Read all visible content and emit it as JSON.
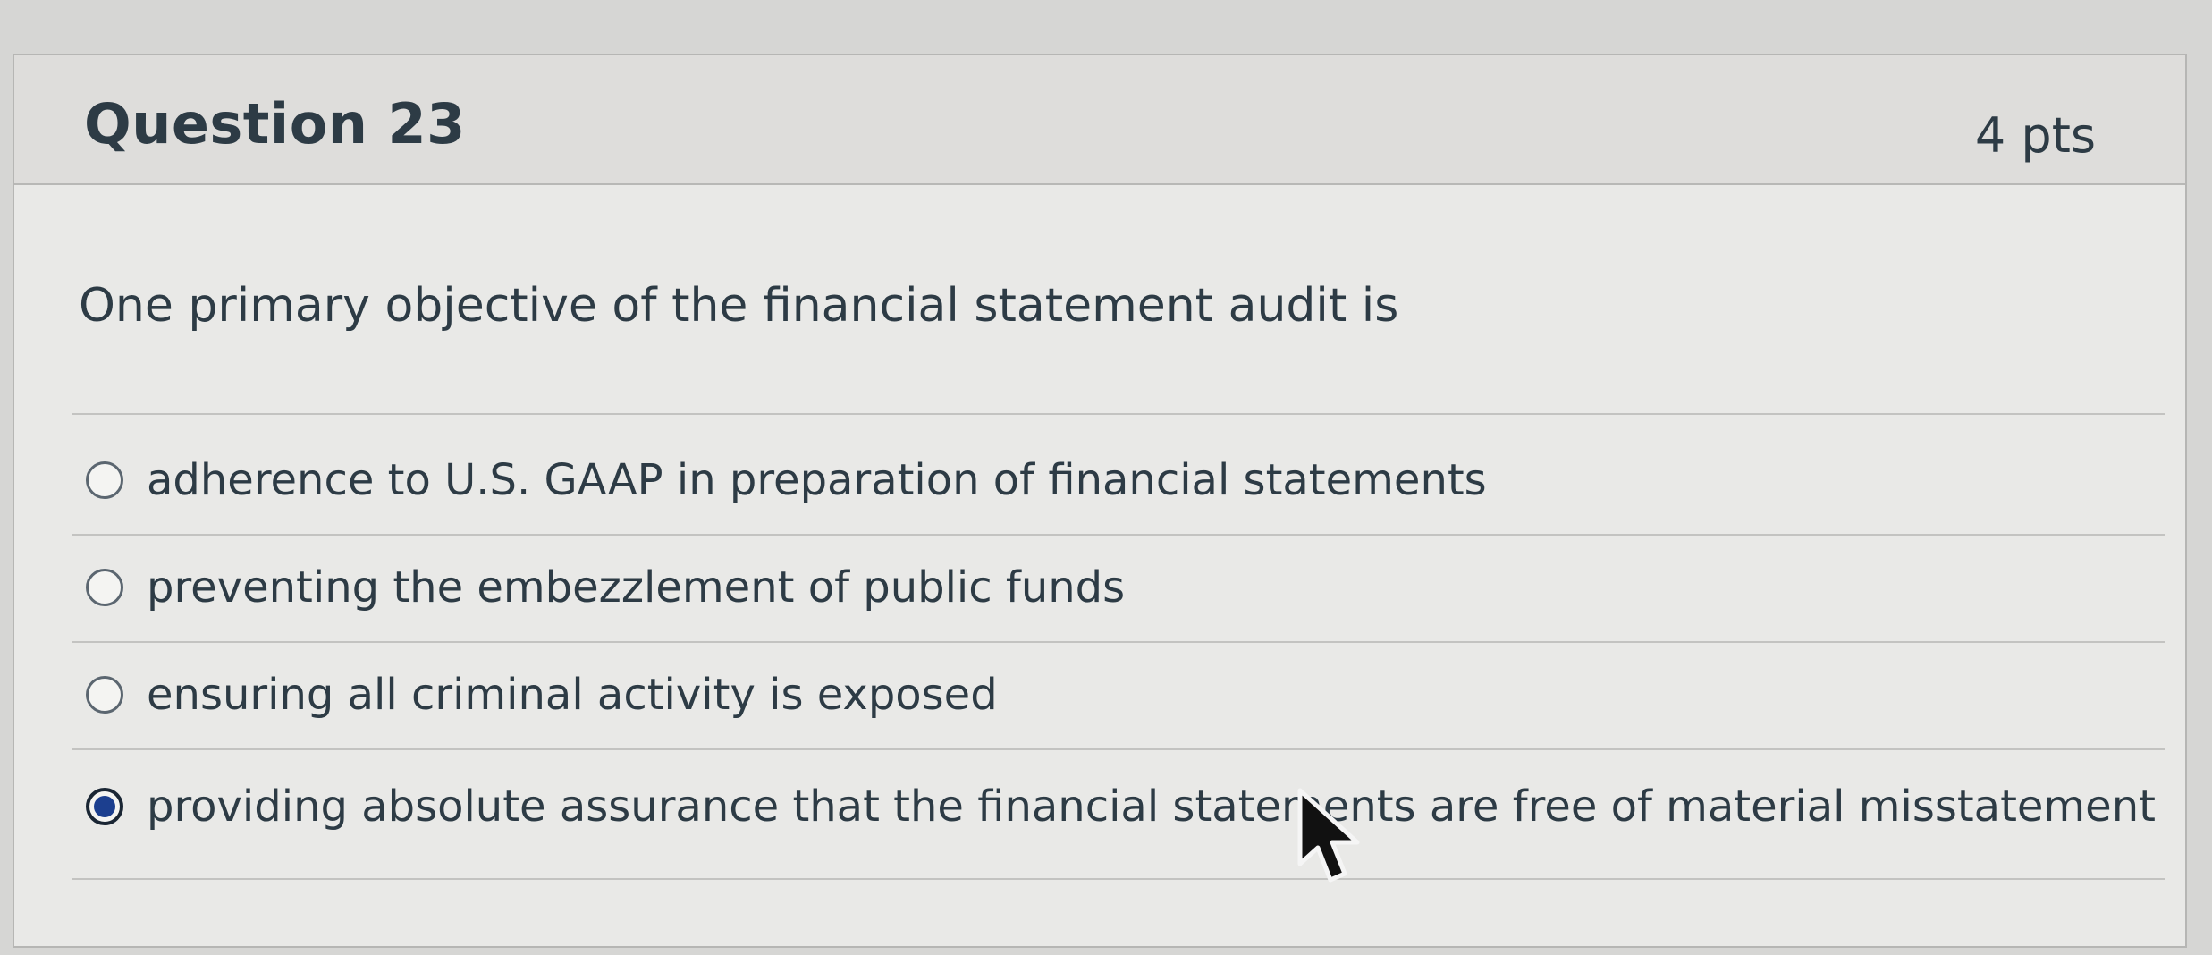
{
  "question": {
    "title": "Question 23",
    "points": "4 pts",
    "prompt": "One primary objective of the financial statement audit is"
  },
  "answers": [
    {
      "label": "adherence to U.S. GAAP in preparation of financial statements",
      "selected": false
    },
    {
      "label": "preventing the embezzlement of public funds",
      "selected": false
    },
    {
      "label": "ensuring all criminal activity is exposed",
      "selected": false
    },
    {
      "label": "providing absolute assurance that the financial statements are free of material misstatement",
      "selected": true
    }
  ],
  "colors": {
    "text": "#2d3b45",
    "selected_radio": "#1c3f8f",
    "card_background": "#e9e9e7",
    "header_background": "#dedddb"
  },
  "icons": {
    "cursor": "mouse-pointer-arrow-icon"
  }
}
